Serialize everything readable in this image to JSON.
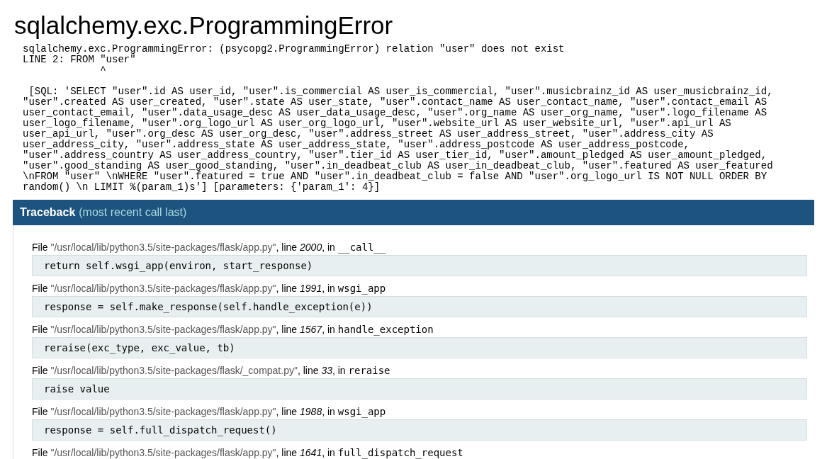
{
  "title": "sqlalchemy.exc.ProgrammingError",
  "error_message": "sqlalchemy.exc.ProgrammingError: (psycopg2.ProgrammingError) relation \"user\" does not exist\nLINE 2: FROM \"user\"\n             ^\n\n [SQL: 'SELECT \"user\".id AS user_id, \"user\".is_commercial AS user_is_commercial, \"user\".musicbrainz_id AS user_musicbrainz_id,\n\"user\".created AS user_created, \"user\".state AS user_state, \"user\".contact_name AS user_contact_name, \"user\".contact_email AS\nuser_contact_email, \"user\".data_usage_desc AS user_data_usage_desc, \"user\".org_name AS user_org_name, \"user\".logo_filename AS\nuser_logo_filename, \"user\".org_logo_url AS user_org_logo_url, \"user\".website_url AS user_website_url, \"user\".api_url AS\nuser_api_url, \"user\".org_desc AS user_org_desc, \"user\".address_street AS user_address_street, \"user\".address_city AS\nuser_address_city, \"user\".address_state AS user_address_state, \"user\".address_postcode AS user_address_postcode,\n\"user\".address_country AS user_address_country, \"user\".tier_id AS user_tier_id, \"user\".amount_pledged AS user_amount_pledged,\n\"user\".good_standing AS user_good_standing, \"user\".in_deadbeat_club AS user_in_deadbeat_club, \"user\".featured AS user_featured\n\\nFROM \"user\" \\nWHERE \"user\".featured = true AND \"user\".in_deadbeat_club = false AND \"user\".org_logo_url IS NOT NULL ORDER BY\nrandom() \\n LIMIT %(param_1)s'] [parameters: {'param_1': 4}]",
  "traceback": {
    "title": "Traceback",
    "subtitle": "(most recent call last)",
    "frames": [
      {
        "file_label": "File",
        "path": "\"/usr/local/lib/python3.5/site-packages/flask/app.py\"",
        "line_label": ", line",
        "line": "2000",
        "in_label": ", in",
        "function": "__call__",
        "code": "return self.wsgi_app(environ, start_response)"
      },
      {
        "file_label": "File",
        "path": "\"/usr/local/lib/python3.5/site-packages/flask/app.py\"",
        "line_label": ", line",
        "line": "1991",
        "in_label": ", in",
        "function": "wsgi_app",
        "code": "response = self.make_response(self.handle_exception(e))"
      },
      {
        "file_label": "File",
        "path": "\"/usr/local/lib/python3.5/site-packages/flask/app.py\"",
        "line_label": ", line",
        "line": "1567",
        "in_label": ", in",
        "function": "handle_exception",
        "code": "reraise(exc_type, exc_value, tb)"
      },
      {
        "file_label": "File",
        "path": "\"/usr/local/lib/python3.5/site-packages/flask/_compat.py\"",
        "line_label": ", line",
        "line": "33",
        "in_label": ", in",
        "function": "reraise",
        "code": "raise value"
      },
      {
        "file_label": "File",
        "path": "\"/usr/local/lib/python3.5/site-packages/flask/app.py\"",
        "line_label": ", line",
        "line": "1988",
        "in_label": ", in",
        "function": "wsgi_app",
        "code": "response = self.full_dispatch_request()"
      },
      {
        "file_label": "File",
        "path": "\"/usr/local/lib/python3.5/site-packages/flask/app.py\"",
        "line_label": ", line",
        "line": "1641",
        "in_label": ", in",
        "function": "full_dispatch_request"
      }
    ]
  }
}
